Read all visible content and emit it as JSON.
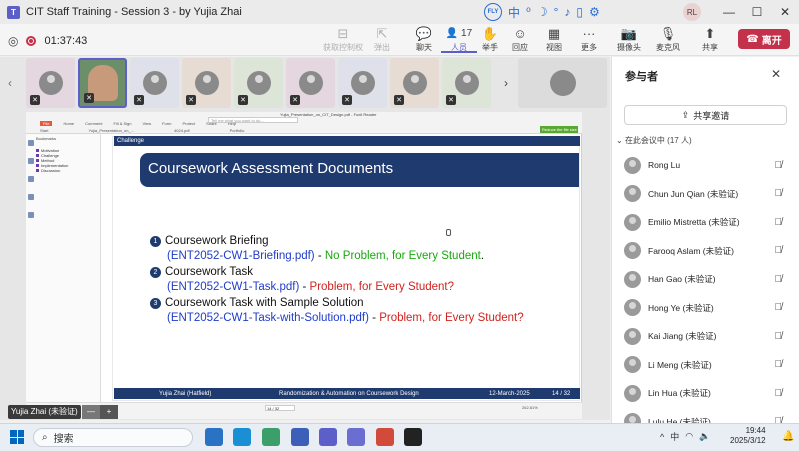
{
  "window": {
    "title": "CIT Staff Training - Session 3 - by Yujia Zhai",
    "app_icon": "teams-icon",
    "user_initials": "RL",
    "minimize": "—",
    "maximize": "☐",
    "close": "✕"
  },
  "ime": {
    "logo": "FLY",
    "lang": "中",
    "items": [
      "中",
      "⁰",
      "☽",
      "°",
      "♪",
      "▯",
      "⚙"
    ]
  },
  "meeting": {
    "elapsed": "01:37:43",
    "toolbar": [
      {
        "label": "获取控制权",
        "icon": "control-icon",
        "glyph": "⊟",
        "disabled": true
      },
      {
        "label": "弹出",
        "icon": "popout-icon",
        "glyph": "⇱",
        "disabled": true
      },
      {
        "label": "聊天",
        "icon": "chat-icon",
        "glyph": "💬"
      },
      {
        "label": "人员",
        "icon": "people-icon",
        "glyph": "👤",
        "count": "17",
        "active": true
      },
      {
        "label": "举手",
        "icon": "raise-hand-icon",
        "glyph": "✋"
      },
      {
        "label": "回应",
        "icon": "react-icon",
        "glyph": "☺"
      },
      {
        "label": "视图",
        "icon": "view-icon",
        "glyph": "▦"
      },
      {
        "label": "更多",
        "icon": "more-icon",
        "glyph": "···"
      },
      {
        "label": "摄像头",
        "icon": "camera-icon",
        "glyph": "📷"
      },
      {
        "label": "麦克风",
        "icon": "mic-off-icon",
        "glyph": "🎙"
      },
      {
        "label": "共享",
        "icon": "share-icon",
        "glyph": "⬆"
      }
    ],
    "leave_label": "离开"
  },
  "presenter_tag": {
    "name": "Yujia Zhai (未验证)",
    "minus": "—",
    "plus": "+"
  },
  "reader": {
    "menu": [
      "File",
      "Home",
      "Comment",
      "Fill & Sign",
      "View",
      "Form",
      "Protect",
      "Share",
      "Help"
    ],
    "search_placeholder": "Tell me what you want to do...",
    "doc_name": "Yujia_Presentation_on_CIT_Design.pdf - Foxit Reader",
    "green_btn": "Reduce the file size",
    "tabs": [
      "Start",
      "Yujia_Presentation_on_...",
      "4024.pdf",
      "Portfolio"
    ],
    "bookmarks_label": "Bookmarks",
    "bookmarks": [
      "Motivation",
      "Challenge",
      "Method",
      "Implementation",
      "Discussion"
    ],
    "page_indicator": "14 / 32",
    "zoom": "262.81%",
    "mini_clock": "19:44\n2025/3/12"
  },
  "slide": {
    "crumb": "Challenge",
    "title": "Coursework Assessment Documents",
    "items": [
      {
        "num": "1",
        "label": "Coursework Briefing",
        "file": "(ENT2052-CW1-Briefing.pdf)",
        "dash": " - ",
        "status": "No Problem, for Every Student",
        "status_type": "ok",
        "end": "."
      },
      {
        "num": "2",
        "label": "Coursework Task",
        "file": "(ENT2052-CW1-Task.pdf)",
        "dash": " - ",
        "status": "Problem, for Every Student?",
        "status_type": "bad",
        "end": ""
      },
      {
        "num": "3",
        "label": "Coursework Task with Sample Solution",
        "file": "(ENT2052-CW1-Task-with-Solution.pdf)",
        "dash": " - ",
        "status": "Problem, for Every Student?",
        "status_type": "bad",
        "end": ""
      }
    ],
    "footer": {
      "author": "Yujia Zhai  (Hatfield)",
      "talk": "Randomization & Automation on Coursework Design",
      "date": "12-March-2025",
      "page": "14 / 32"
    }
  },
  "participants_panel": {
    "title": "参与者",
    "close": "✕",
    "share_invite": "共享邀请",
    "section": "在此会议中 (17 人)",
    "people": [
      "Rong Lu",
      "Chun Jun Qian (未验证)",
      "Emilio Mistretta (未验证)",
      "Farooq Aslam (未验证)",
      "Han Gao (未验证)",
      "Hong Ye (未验证)",
      "Kai Jiang (未验证)",
      "Li Meng (未验证)",
      "Lin Hua (未验证)",
      "Lulu He (未验证)"
    ]
  },
  "taskbar": {
    "search": "搜索",
    "tray_lang": "中",
    "tray_up": "^",
    "time": "19:44",
    "date": "2025/3/12",
    "apps": [
      "file-explorer-icon",
      "edge-icon",
      "photos-icon",
      "store-icon",
      "teams-icon",
      "teams-icon",
      "foxit-icon",
      "qq-icon"
    ],
    "app_colors": [
      "#2a72c4",
      "#1a8fd6",
      "#3c9f6a",
      "#3c5fb8",
      "#5b5fc7",
      "#6a6ed1",
      "#d24a3a",
      "#222222"
    ]
  },
  "colors": {
    "accent": "#5b5fc7",
    "leave": "#c4314b",
    "slide_navy": "#1e3a6e",
    "link_blue": "#1f3cc9",
    "ok_green": "#1aa80e",
    "bad_red": "#d0221e"
  }
}
